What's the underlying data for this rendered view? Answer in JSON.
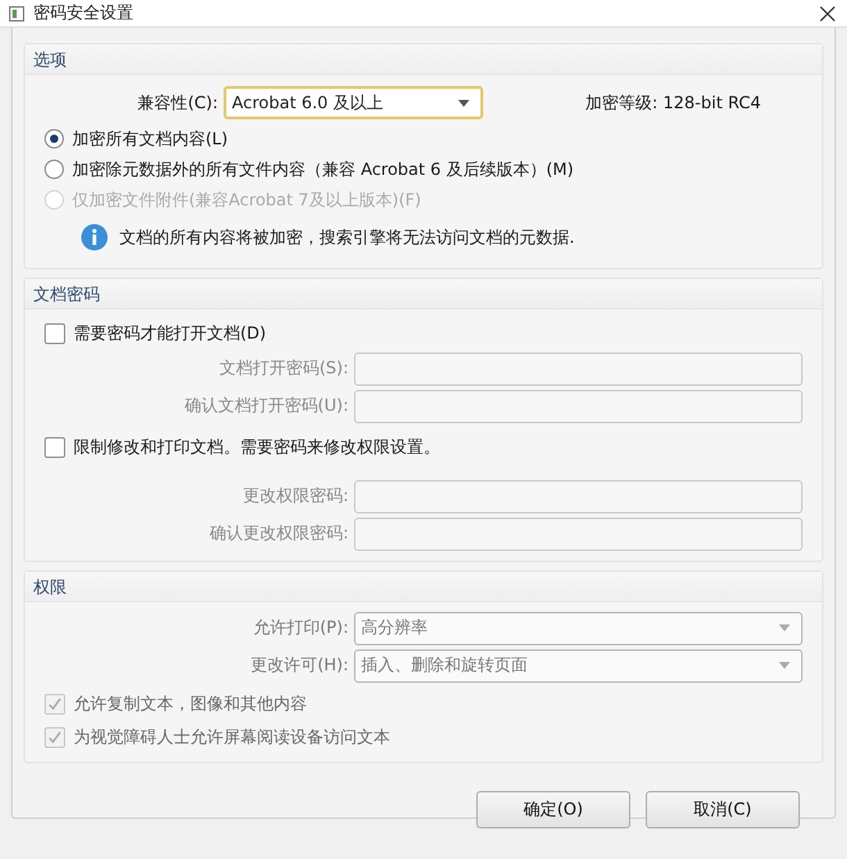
{
  "window": {
    "title": "密码安全设置"
  },
  "options": {
    "heading": "选项",
    "compat_label": "兼容性(C):",
    "compat_value": "Acrobat 6.0 及以上",
    "level_label": "加密等级: 128-bit RC4",
    "radios": [
      {
        "label": "加密所有文档内容(L)",
        "selected": true,
        "disabled": false
      },
      {
        "label": "加密除元数据外的所有文件内容（兼容 Acrobat 6 及后续版本）(M)",
        "selected": false,
        "disabled": false
      },
      {
        "label": "仅加密文件附件(兼容Acrobat 7及以上版本)(F)",
        "selected": false,
        "disabled": true
      }
    ],
    "info": "文档的所有内容将被加密，搜索引擎将无法访问文档的元数据."
  },
  "password": {
    "heading": "文档密码",
    "groups": [
      {
        "checkbox": {
          "label": "需要密码才能打开文档(D)",
          "checked": false
        },
        "fields": [
          {
            "label": "文档打开密码(S):",
            "disabled": true
          },
          {
            "label": "确认文档打开密码(U):",
            "disabled": true
          }
        ]
      },
      {
        "checkbox": {
          "label": "限制修改和打印文档。需要密码来修改权限设置。",
          "checked": false
        },
        "fields": [
          {
            "label": "更改权限密码:",
            "disabled": true
          },
          {
            "label": "确认更改权限密码:",
            "disabled": true
          }
        ]
      }
    ]
  },
  "permissions": {
    "heading": "权限",
    "selects": [
      {
        "label": "允许打印(P):",
        "value": "高分辨率",
        "disabled": true
      },
      {
        "label": "更改许可(H):",
        "value": "插入、删除和旋转页面",
        "disabled": true
      }
    ],
    "checkboxes": [
      {
        "label": "允许复制文本，图像和其他内容",
        "checked": true,
        "disabled": true
      },
      {
        "label": "为视觉障碍人士允许屏幕阅读设备访问文本",
        "checked": true,
        "disabled": true
      }
    ]
  },
  "buttons": [
    "确定(O)",
    "取消(C)"
  ]
}
